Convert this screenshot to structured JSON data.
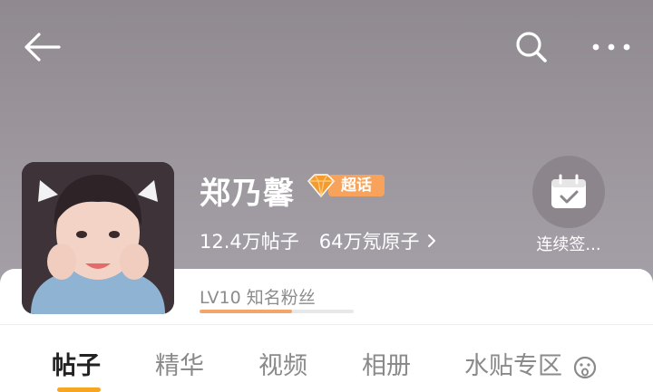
{
  "nav": {
    "back_icon": "arrow-left-icon",
    "search_icon": "search-icon",
    "more_icon": "more-horizontal-icon"
  },
  "profile": {
    "name": "郑乃馨",
    "badge_label": "超话",
    "posts_count": "12.4万",
    "posts_unit": "帖子",
    "atoms_count": "64万",
    "atoms_unit": "氖原子",
    "checkin_label": "连续签..."
  },
  "level": {
    "label": "LV10 知名粉丝",
    "progress": 0.6
  },
  "tabs": [
    {
      "label": "帖子",
      "active": true
    },
    {
      "label": "精华",
      "active": false
    },
    {
      "label": "视频",
      "active": false
    },
    {
      "label": "相册",
      "active": false
    },
    {
      "label": "水贴专区",
      "active": false
    }
  ],
  "colors": {
    "accent": "#f6a623",
    "badge": "#f7a35c",
    "header_bg": "#9b959b"
  }
}
